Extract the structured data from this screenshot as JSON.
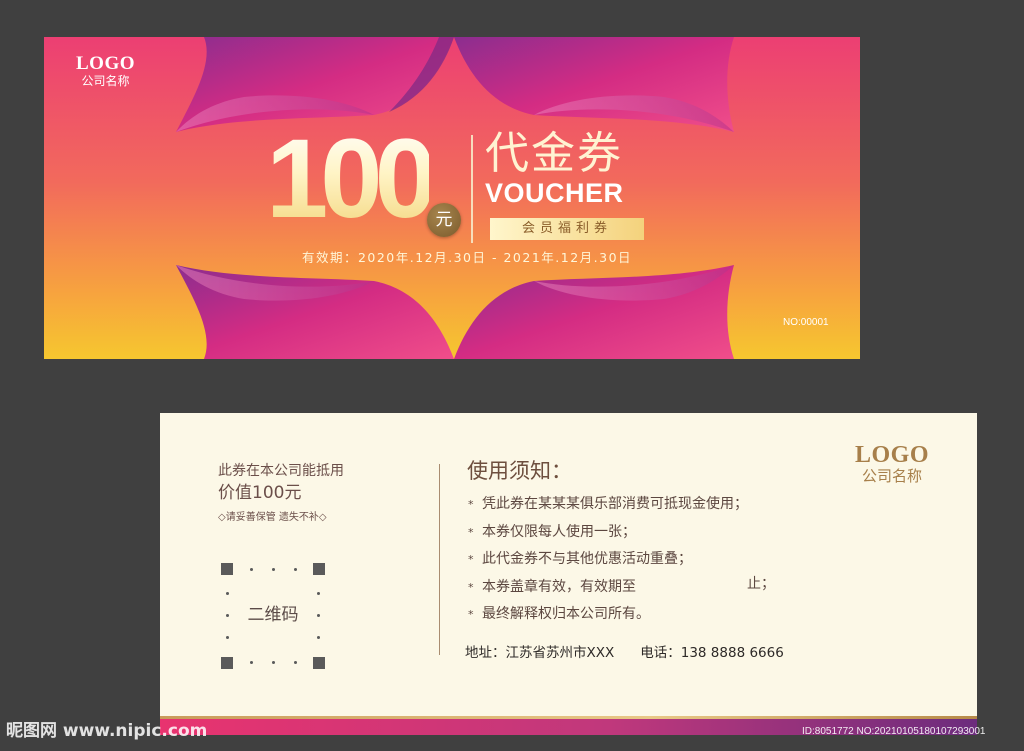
{
  "front": {
    "logo": "LOGO",
    "company": "公司名称",
    "amount": "100",
    "unit": "元",
    "title_cn": "代金券",
    "title_en": "VOUCHER",
    "tag": "会员福利券",
    "validity": "有效期：2020年.12月.30日 - 2021年.12月.30日",
    "serial": "NO:00001"
  },
  "back": {
    "intro_line1": "此券在本公司能抵用",
    "intro_line2": "价值100元",
    "intro_note": "◇请妥善保管 遗失不补◇",
    "qr_label": "二维码",
    "notice_title": "使用须知：",
    "notices": [
      "凭此券在某某某俱乐部消费可抵现金使用；",
      "本券仅限每人使用一张；",
      "此代金券不与其他优惠活动重叠；",
      "本券盖章有效，有效期至",
      "最终解释权归本公司所有。"
    ],
    "notice_end": "止；",
    "address_label": "地址：",
    "address": "江苏省苏州市XXX",
    "phone_label": "电话：",
    "phone": "138 8888 6666",
    "logo": "LOGO",
    "company": "公司名称"
  },
  "watermark": {
    "site": "昵图网 www.nipic.com",
    "id": "ID:8051772 NO:20210105180107293001"
  },
  "colors": {
    "front_top": "#ec3f73",
    "front_bottom": "#f6c72f",
    "petal": "#c8287f",
    "back_bg": "#fcf8e7",
    "gold": "#a77f4a"
  }
}
